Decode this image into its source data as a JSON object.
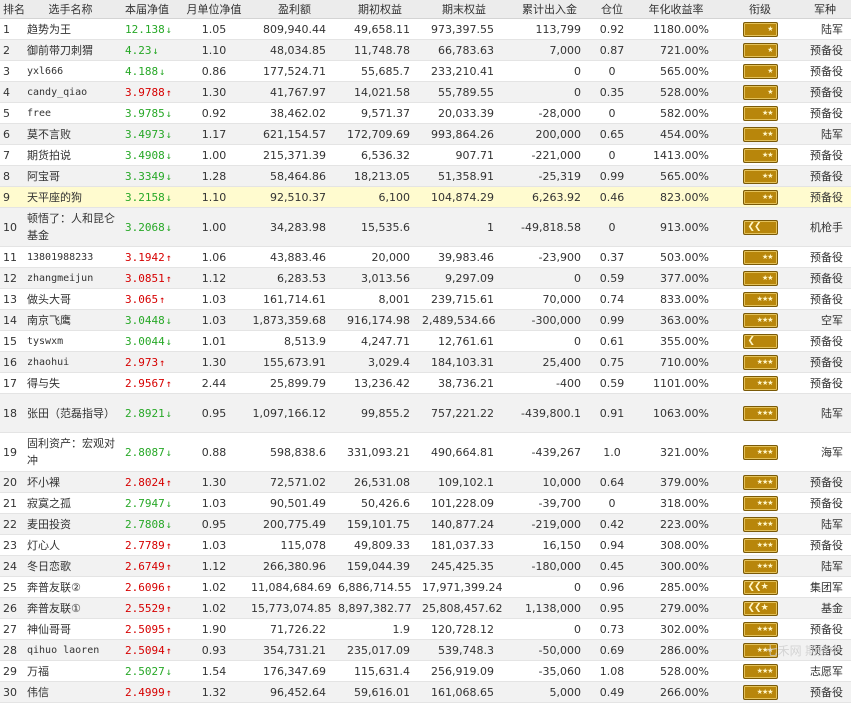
{
  "headers": [
    "排名",
    "选手名称",
    "本届净值",
    "月单位净值",
    "盈利额",
    "期初权益",
    "期末权益",
    "累计出入金",
    "仓位",
    "年化收益率",
    "衔级",
    "军种"
  ],
  "rows": [
    {
      "rank": "1",
      "name": "趋势为王",
      "nav": "12.138",
      "dir": "down",
      "month": "1.05",
      "profit": "809,940.44",
      "start": "49,658.11",
      "end": "973,397.55",
      "flow": "113,799",
      "pos": "0.92",
      "annual": "1180.00%",
      "badge": "one",
      "branch": "陆军"
    },
    {
      "rank": "2",
      "name": "御前带刀刺猬",
      "nav": "4.23",
      "dir": "down",
      "month": "1.10",
      "profit": "48,034.85",
      "start": "11,748.78",
      "end": "66,783.63",
      "flow": "7,000",
      "pos": "0.87",
      "annual": "721.00%",
      "badge": "one",
      "branch": "预备役"
    },
    {
      "rank": "3",
      "name": "yxl666",
      "nav": "4.188",
      "dir": "down",
      "month": "0.86",
      "profit": "177,524.71",
      "start": "55,685.7",
      "end": "233,210.41",
      "flow": "0",
      "pos": "0",
      "annual": "565.00%",
      "badge": "one",
      "branch": "预备役"
    },
    {
      "rank": "4",
      "name": "candy_qiao",
      "nav": "3.9788",
      "dir": "up",
      "month": "1.30",
      "profit": "41,767.97",
      "start": "14,021.58",
      "end": "55,789.55",
      "flow": "0",
      "pos": "0.35",
      "annual": "528.00%",
      "badge": "one",
      "branch": "预备役"
    },
    {
      "rank": "5",
      "name": "free",
      "nav": "3.9785",
      "dir": "down",
      "month": "0.92",
      "profit": "38,462.02",
      "start": "9,571.37",
      "end": "20,033.39",
      "flow": "-28,000",
      "pos": "0",
      "annual": "582.00%",
      "badge": "two",
      "branch": "预备役"
    },
    {
      "rank": "6",
      "name": "莫不言败",
      "nav": "3.4973",
      "dir": "down",
      "month": "1.17",
      "profit": "621,154.57",
      "start": "172,709.69",
      "end": "993,864.26",
      "flow": "200,000",
      "pos": "0.65",
      "annual": "454.00%",
      "badge": "two",
      "branch": "陆军"
    },
    {
      "rank": "7",
      "name": "期货拍说",
      "nav": "3.4908",
      "dir": "down",
      "month": "1.00",
      "profit": "215,371.39",
      "start": "6,536.32",
      "end": "907.71",
      "flow": "-221,000",
      "pos": "0",
      "annual": "1413.00%",
      "badge": "two",
      "branch": "预备役"
    },
    {
      "rank": "8",
      "name": "阿宝哥",
      "nav": "3.3349",
      "dir": "down",
      "month": "1.28",
      "profit": "58,464.86",
      "start": "18,213.05",
      "end": "51,358.91",
      "flow": "-25,319",
      "pos": "0.99",
      "annual": "565.00%",
      "badge": "two",
      "branch": "预备役"
    },
    {
      "rank": "9",
      "name": "天平座的狗",
      "nav": "3.2158",
      "dir": "down",
      "month": "1.10",
      "profit": "92,510.37",
      "start": "6,100",
      "end": "104,874.29",
      "flow": "6,263.92",
      "pos": "0.46",
      "annual": "823.00%",
      "badge": "two",
      "branch": "预备役"
    },
    {
      "rank": "10",
      "name": "顿悟了：人和昆仑基金",
      "nav": "3.2068",
      "dir": "down",
      "month": "1.00",
      "profit": "34,283.98",
      "start": "15,535.6",
      "end": "1",
      "flow": "-49,818.58",
      "pos": "0",
      "annual": "913.00%",
      "badge": "chev2",
      "branch": "机枪手"
    },
    {
      "rank": "11",
      "name": "13801988233",
      "nav": "3.1942",
      "dir": "up",
      "month": "1.06",
      "profit": "43,883.46",
      "start": "20,000",
      "end": "39,983.46",
      "flow": "-23,900",
      "pos": "0.37",
      "annual": "503.00%",
      "badge": "two",
      "branch": "预备役"
    },
    {
      "rank": "12",
      "name": "zhangmeijun",
      "nav": "3.0851",
      "dir": "up",
      "month": "1.12",
      "profit": "6,283.53",
      "start": "3,013.56",
      "end": "9,297.09",
      "flow": "0",
      "pos": "0.59",
      "annual": "377.00%",
      "badge": "two",
      "branch": "预备役"
    },
    {
      "rank": "13",
      "name": "做头大哥",
      "nav": "3.065",
      "dir": "up",
      "month": "1.03",
      "profit": "161,714.61",
      "start": "8,001",
      "end": "239,715.61",
      "flow": "70,000",
      "pos": "0.74",
      "annual": "833.00%",
      "badge": "three",
      "branch": "预备役"
    },
    {
      "rank": "14",
      "name": "南京飞鹰",
      "nav": "3.0448",
      "dir": "down",
      "month": "1.03",
      "profit": "1,873,359.68",
      "start": "916,174.98",
      "end": "2,489,534.66",
      "flow": "-300,000",
      "pos": "0.99",
      "annual": "363.00%",
      "badge": "three",
      "branch": "空军"
    },
    {
      "rank": "15",
      "name": "tyswxm",
      "nav": "3.0044",
      "dir": "down",
      "month": "1.01",
      "profit": "8,513.9",
      "start": "4,247.71",
      "end": "12,761.61",
      "flow": "0",
      "pos": "0.61",
      "annual": "355.00%",
      "badge": "chev1",
      "branch": "预备役"
    },
    {
      "rank": "16",
      "name": "zhaohui",
      "nav": "2.973",
      "dir": "up",
      "month": "1.30",
      "profit": "155,673.91",
      "start": "3,029.4",
      "end": "184,103.31",
      "flow": "25,400",
      "pos": "0.75",
      "annual": "710.00%",
      "badge": "three",
      "branch": "预备役"
    },
    {
      "rank": "17",
      "name": "得与失",
      "nav": "2.9567",
      "dir": "up",
      "month": "2.44",
      "profit": "25,899.79",
      "start": "13,236.42",
      "end": "38,736.21",
      "flow": "-400",
      "pos": "0.59",
      "annual": "1101.00%",
      "badge": "three",
      "branch": "预备役"
    },
    {
      "rank": "18",
      "name": "张田（范磊指导）",
      "nav": "2.8921",
      "dir": "down",
      "month": "0.95",
      "profit": "1,097,166.12",
      "start": "99,855.2",
      "end": "757,221.22",
      "flow": "-439,800.1",
      "pos": "0.91",
      "annual": "1063.00%",
      "badge": "three",
      "branch": "陆军"
    },
    {
      "rank": "19",
      "name": "固利资产：宏观对冲",
      "nav": "2.8087",
      "dir": "down",
      "month": "0.88",
      "profit": "598,838.6",
      "start": "331,093.21",
      "end": "490,664.81",
      "flow": "-439,267",
      "pos": "1.0",
      "annual": "321.00%",
      "badge": "three",
      "branch": "海军"
    },
    {
      "rank": "20",
      "name": "坏小裸",
      "nav": "2.8024",
      "dir": "up",
      "month": "1.30",
      "profit": "72,571.02",
      "start": "26,531.08",
      "end": "109,102.1",
      "flow": "10,000",
      "pos": "0.64",
      "annual": "379.00%",
      "badge": "three",
      "branch": "预备役"
    },
    {
      "rank": "21",
      "name": "寂寞之孤",
      "nav": "2.7947",
      "dir": "down",
      "month": "1.03",
      "profit": "90,501.49",
      "start": "50,426.6",
      "end": "101,228.09",
      "flow": "-39,700",
      "pos": "0",
      "annual": "318.00%",
      "badge": "three",
      "branch": "预备役"
    },
    {
      "rank": "22",
      "name": "麦田投资",
      "nav": "2.7808",
      "dir": "down",
      "month": "0.95",
      "profit": "200,775.49",
      "start": "159,101.75",
      "end": "140,877.24",
      "flow": "-219,000",
      "pos": "0.42",
      "annual": "223.00%",
      "badge": "three",
      "branch": "陆军"
    },
    {
      "rank": "23",
      "name": "灯心人",
      "nav": "2.7789",
      "dir": "up",
      "month": "1.03",
      "profit": "115,078",
      "start": "49,809.33",
      "end": "181,037.33",
      "flow": "16,150",
      "pos": "0.94",
      "annual": "308.00%",
      "badge": "three",
      "branch": "预备役"
    },
    {
      "rank": "24",
      "name": "冬日恋歌",
      "nav": "2.6749",
      "dir": "up",
      "month": "1.12",
      "profit": "266,380.96",
      "start": "159,044.39",
      "end": "245,425.35",
      "flow": "-180,000",
      "pos": "0.45",
      "annual": "300.00%",
      "badge": "three",
      "branch": "陆军"
    },
    {
      "rank": "25",
      "name": "奔普友联②",
      "nav": "2.6096",
      "dir": "up",
      "month": "1.02",
      "profit": "11,084,684.69",
      "start": "6,886,714.55",
      "end": "17,971,399.24",
      "flow": "0",
      "pos": "0.96",
      "annual": "285.00%",
      "badge": "chev3",
      "branch": "集团军"
    },
    {
      "rank": "26",
      "name": "奔普友联①",
      "nav": "2.5529",
      "dir": "up",
      "month": "1.02",
      "profit": "15,773,074.85",
      "start": "8,897,382.77",
      "end": "25,808,457.62",
      "flow": "1,138,000",
      "pos": "0.95",
      "annual": "279.00%",
      "badge": "chev3",
      "branch": "基金"
    },
    {
      "rank": "27",
      "name": "神仙哥哥",
      "nav": "2.5095",
      "dir": "up",
      "month": "1.90",
      "profit": "71,726.22",
      "start": "1.9",
      "end": "120,728.12",
      "flow": "0",
      "pos": "0.73",
      "annual": "302.00%",
      "badge": "three",
      "branch": "预备役"
    },
    {
      "rank": "28",
      "name": "qihuo laoren",
      "nav": "2.5094",
      "dir": "up",
      "month": "0.93",
      "profit": "354,731.21",
      "start": "235,017.09",
      "end": "539,748.3",
      "flow": "-50,000",
      "pos": "0.69",
      "annual": "286.00%",
      "badge": "three",
      "branch": "预备役"
    },
    {
      "rank": "29",
      "name": "万福",
      "nav": "2.5027",
      "dir": "down",
      "month": "1.54",
      "profit": "176,347.69",
      "start": "115,631.4",
      "end": "256,919.09",
      "flow": "-35,060",
      "pos": "1.08",
      "annual": "528.00%",
      "badge": "three",
      "branch": "志愿军"
    },
    {
      "rank": "30",
      "name": "伟信",
      "nav": "2.4999",
      "dir": "up",
      "month": "1.32",
      "profit": "96,452.64",
      "start": "59,616.01",
      "end": "161,068.65",
      "flow": "5,000",
      "pos": "0.49",
      "annual": "266.00%",
      "badge": "three",
      "branch": "预备役"
    }
  ],
  "watermark": "七禾网 期货中"
}
